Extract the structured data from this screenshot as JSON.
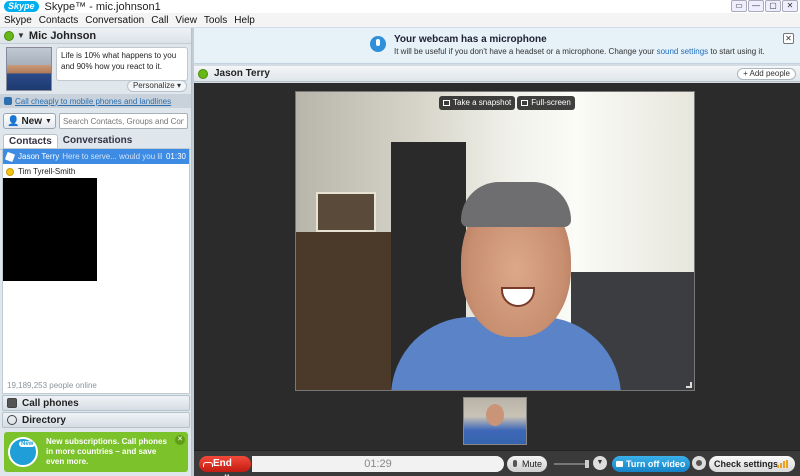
{
  "window": {
    "logo": "Skype",
    "title": "Skype™ - mic.johnson1",
    "controls": [
      "▭",
      "—",
      "▢",
      "✕"
    ]
  },
  "menu": [
    "Skype",
    "Contacts",
    "Conversation",
    "Call",
    "View",
    "Tools",
    "Help"
  ],
  "profile": {
    "name": "Mic Johnson",
    "mood": "Life is 10% what happens to you and 90% how you react to it.",
    "personalize_label": "Personalize ▾",
    "call_cheap_link": "Call cheaply to mobile phones and landlines"
  },
  "toolbar": {
    "new_label": "New",
    "search_placeholder": "Search Contacts, Groups and Conversati..."
  },
  "tabs": {
    "contacts": "Contacts",
    "conversations": "Conversations"
  },
  "contacts": [
    {
      "name": "Jason Terry",
      "message": "Here to serve... would you like fri...",
      "time": "01:30"
    },
    {
      "name": "Tim Tyrell-Smith",
      "message": "",
      "time": ""
    }
  ],
  "online_count": "19,189,253 people online",
  "nav": {
    "call_phones": "Call phones",
    "directory": "Directory"
  },
  "promo": {
    "badge": "New",
    "text": "New subscriptions. Call phones in more countries – and save even more.",
    "close": "✕"
  },
  "notice": {
    "title": "Your webcam has a microphone",
    "desc_before": "It will be useful if you don't have a headset or a microphone. Change your ",
    "desc_link": "sound settings",
    "desc_after": " to start using it.",
    "close": "✕"
  },
  "call": {
    "contact_name": "Jason Terry",
    "add_people": "+ Add people",
    "snapshot_label": "Take a snapshot",
    "fullscreen_label": "Full-screen",
    "end_call_label": "End call",
    "duration": "01:29",
    "mute_label": "Mute",
    "video_label": "Turn off video",
    "check_settings_label": "Check settings"
  },
  "colors": {
    "accent": "#00aff0",
    "online_green": "#67b814",
    "end_call_red": "#d8261a",
    "promo_green": "#7cc22a",
    "selection_blue": "#3d8be2"
  }
}
